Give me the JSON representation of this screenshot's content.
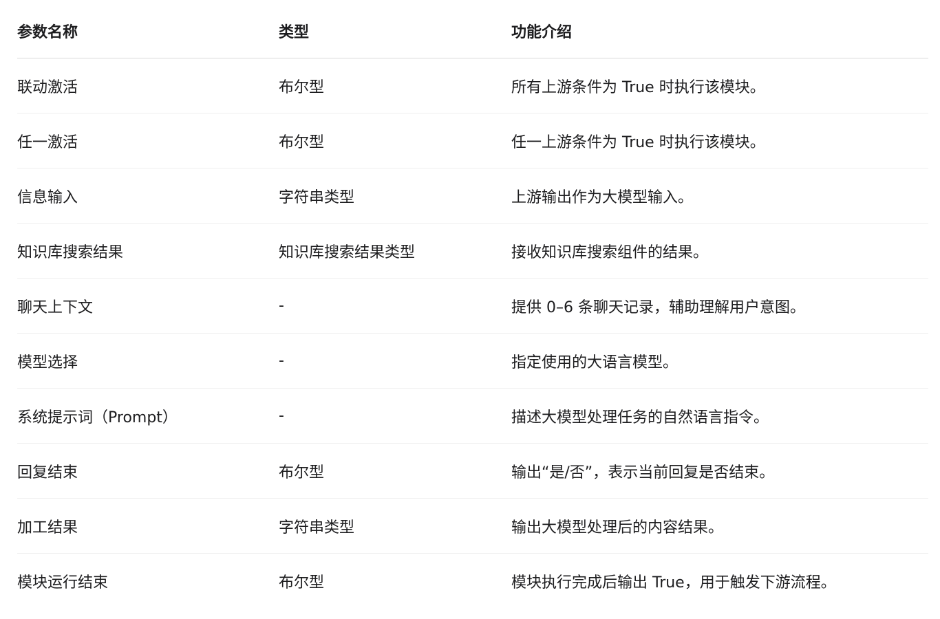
{
  "table": {
    "headers": [
      "参数名称",
      "类型",
      "功能介绍"
    ],
    "rows": [
      [
        "联动激活",
        "布尔型",
        "所有上游条件为 True 时执行该模块。"
      ],
      [
        "任一激活",
        "布尔型",
        "任一上游条件为 True 时执行该模块。"
      ],
      [
        "信息输入",
        "字符串类型",
        "上游输出作为大模型输入。"
      ],
      [
        "知识库搜索结果",
        "知识库搜索结果类型",
        "接收知识库搜索组件的结果。"
      ],
      [
        "聊天上下文",
        "-",
        "提供 0–6 条聊天记录，辅助理解用户意图。"
      ],
      [
        "模型选择",
        "-",
        "指定使用的大语言模型。"
      ],
      [
        "系统提示词（Prompt）",
        "-",
        "描述大模型处理任务的自然语言指令。"
      ],
      [
        "回复结束",
        "布尔型",
        "输出“是/否”，表示当前回复是否结束。"
      ],
      [
        "加工结果",
        "字符串类型",
        "输出大模型处理后的内容结果。"
      ],
      [
        "模块运行结束",
        "布尔型",
        "模块执行完成后输出 True，用于触发下游流程。"
      ]
    ]
  }
}
